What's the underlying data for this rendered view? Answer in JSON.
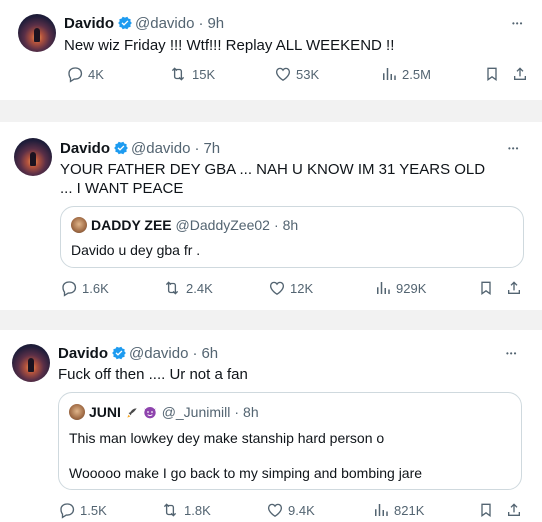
{
  "tweets": [
    {
      "name": "Davido",
      "handle": "@davido",
      "time": "9h",
      "text": "New wiz Friday !!! Wtf!!! Replay ALL WEEKEND !!",
      "replies": "4K",
      "reposts": "15K",
      "likes": "53K",
      "views": "2.5M"
    },
    {
      "name": "Davido",
      "handle": "@davido",
      "time": "7h",
      "text": "YOUR FATHER  DEY GBA ... NAH U KNOW IM 31 YEARS OLD ... I WANT PEACE",
      "quote": {
        "name": "DADDY ZEE",
        "handle": "@DaddyZee02",
        "time": "8h",
        "text": "Davido u dey gba fr ."
      },
      "replies": "1.6K",
      "reposts": "2.4K",
      "likes": "12K",
      "views": "929K"
    },
    {
      "name": "Davido",
      "handle": "@davido",
      "time": "6h",
      "text": "Fuck off then .... Ur not a fan",
      "quote": {
        "name": "JUNI",
        "handle": "@_Junimill",
        "time": "8h",
        "text_line1": "This man lowkey dey make stanship hard person o",
        "text_line2": "Wooooo make I go back to my simping and bombing jare"
      },
      "replies": "1.5K",
      "reposts": "1.8K",
      "likes": "9.4K",
      "views": "821K"
    }
  ],
  "separator": "·",
  "more_glyph": "•••",
  "colors": {
    "text": "#0f1419",
    "secondary": "#536471",
    "verified": "#1d9bf0",
    "border": "#cfd9de",
    "gap": "#f2f2f2"
  },
  "icons": [
    "verified-badge-icon",
    "more-icon",
    "reply-icon",
    "repost-icon",
    "like-icon",
    "views-icon",
    "bookmark-icon",
    "share-icon"
  ]
}
